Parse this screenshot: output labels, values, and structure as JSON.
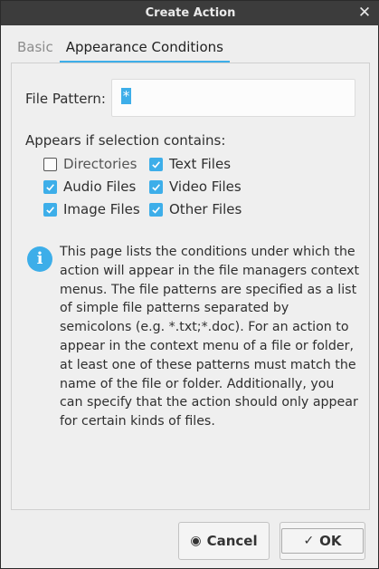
{
  "window": {
    "title": "Create Action"
  },
  "tabs": [
    {
      "label": "Basic",
      "active": false
    },
    {
      "label": "Appearance Conditions",
      "active": true
    }
  ],
  "file_pattern": {
    "label": "File Pattern:",
    "value": "*"
  },
  "appears_label": "Appears if selection contains:",
  "checkboxes": [
    {
      "label": "Directories",
      "checked": false
    },
    {
      "label": "Text Files",
      "checked": true
    },
    {
      "label": "Audio Files",
      "checked": true
    },
    {
      "label": "Video Files",
      "checked": true
    },
    {
      "label": "Image Files",
      "checked": true
    },
    {
      "label": "Other Files",
      "checked": true
    }
  ],
  "info": {
    "icon": "info-icon",
    "text": "This page lists the conditions under which the action will appear in the file managers context menus. The file patterns are specified as a list of simple file patterns separated by semicolons (e.g. *.txt;*.doc). For an action to appear in the context menu of a file or folder, at least one of these patterns must match the name of the file or folder. Additionally, you can specify that the action should only appear for certain kinds of files."
  },
  "buttons": {
    "cancel": {
      "label": "Cancel",
      "icon": "cancel-icon"
    },
    "ok": {
      "label": "OK",
      "icon": "check-icon"
    }
  },
  "colors": {
    "accent": "#3daee9",
    "titlebar": "#3c3c3c"
  }
}
